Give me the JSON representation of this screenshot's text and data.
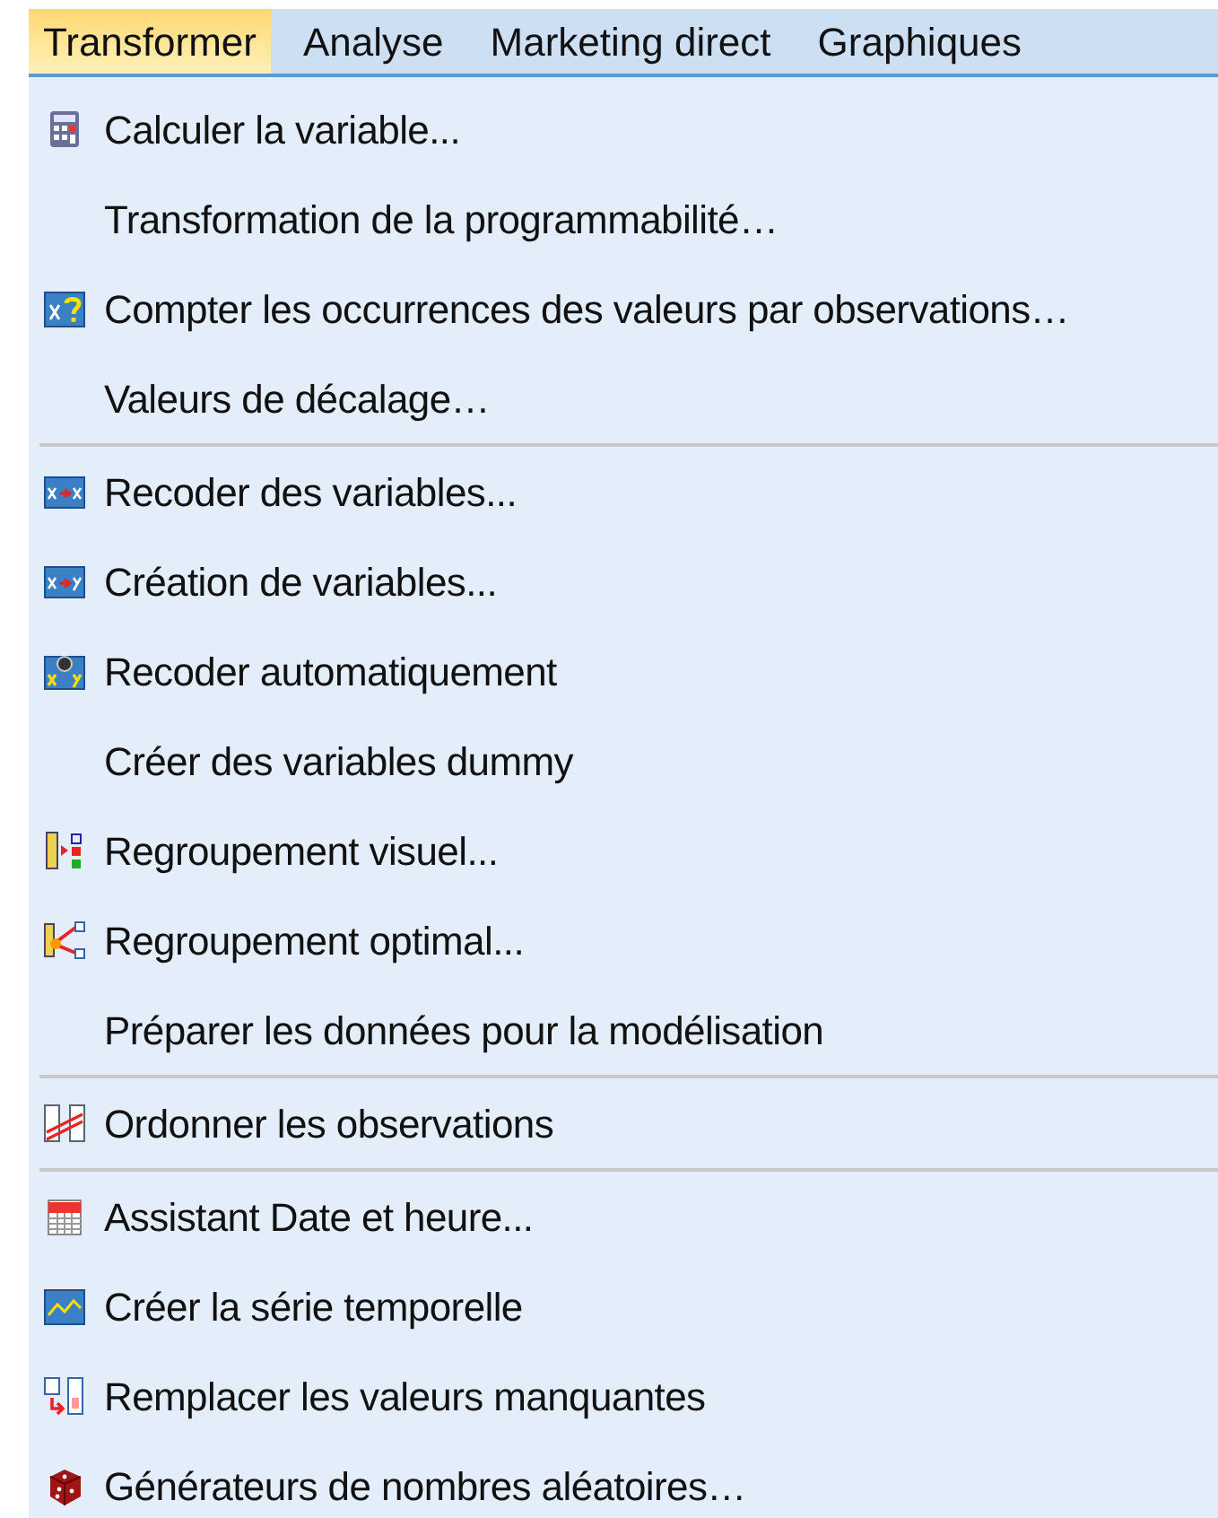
{
  "menu_bar": [
    {
      "label": "Transformer",
      "selected": true
    },
    {
      "label": "Analyse",
      "selected": false
    },
    {
      "label": "Marketing direct",
      "selected": false
    },
    {
      "label": "Graphiques",
      "selected": false
    }
  ],
  "menu": [
    {
      "kind": "item",
      "label": "Calculer la variable...",
      "icon": true
    },
    {
      "kind": "item",
      "label": "Transformation de la programmabilité…",
      "icon": false
    },
    {
      "kind": "item",
      "label": "Compter les occurrences des valeurs par observations…",
      "icon": true
    },
    {
      "kind": "item",
      "label": "Valeurs de décalage…",
      "icon": false
    },
    {
      "kind": "separator"
    },
    {
      "kind": "item",
      "label": "Recoder des variables...",
      "icon": true
    },
    {
      "kind": "item",
      "label": "Création de variables...",
      "icon": true
    },
    {
      "kind": "item",
      "label": "Recoder automatiquement",
      "icon": true
    },
    {
      "kind": "item",
      "label": "Créer des variables dummy",
      "icon": false
    },
    {
      "kind": "item",
      "label": "Regroupement visuel...",
      "icon": true
    },
    {
      "kind": "item",
      "label": "Regroupement optimal...",
      "icon": true
    },
    {
      "kind": "item",
      "label": "Préparer les données pour la modélisation",
      "icon": false
    },
    {
      "kind": "separator"
    },
    {
      "kind": "item",
      "label": "Ordonner les observations",
      "icon": true
    },
    {
      "kind": "separator"
    },
    {
      "kind": "item",
      "label": "Assistant Date et heure...",
      "icon": true
    },
    {
      "kind": "item",
      "label": "Créer la série temporelle",
      "icon": true
    },
    {
      "kind": "item",
      "label": "Remplacer les valeurs manquantes",
      "icon": true
    },
    {
      "kind": "item",
      "label": "Générateurs de nombres aléatoires…",
      "icon": true
    }
  ]
}
